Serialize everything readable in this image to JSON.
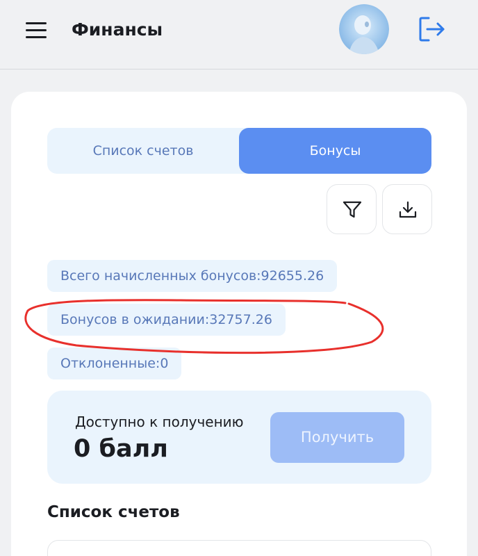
{
  "header": {
    "title": "Финансы",
    "menu_icon": "hamburger-menu-icon",
    "logout_icon": "logout-icon"
  },
  "tabs": [
    {
      "label": "Список счетов",
      "active": false
    },
    {
      "label": "Бонусы",
      "active": true
    }
  ],
  "toolbar": {
    "filter_icon": "filter-icon",
    "download_icon": "download-icon"
  },
  "stats": {
    "total": "Всего начисленных бонусов:92655.26",
    "pending": "Бонусов в ожидании:32757.26",
    "rejected": "Отклоненные:0"
  },
  "available": {
    "label": "Доступно к получению",
    "value": "0 балл",
    "button_label": "Получить"
  },
  "list_section": {
    "title": "Список счетов"
  },
  "colors": {
    "accent": "#5b8ef1",
    "chip_bg": "#eaf4fd",
    "chip_text": "#5878b8",
    "button_disabled": "#9dbcf6",
    "annotation_red": "#e8302c"
  }
}
